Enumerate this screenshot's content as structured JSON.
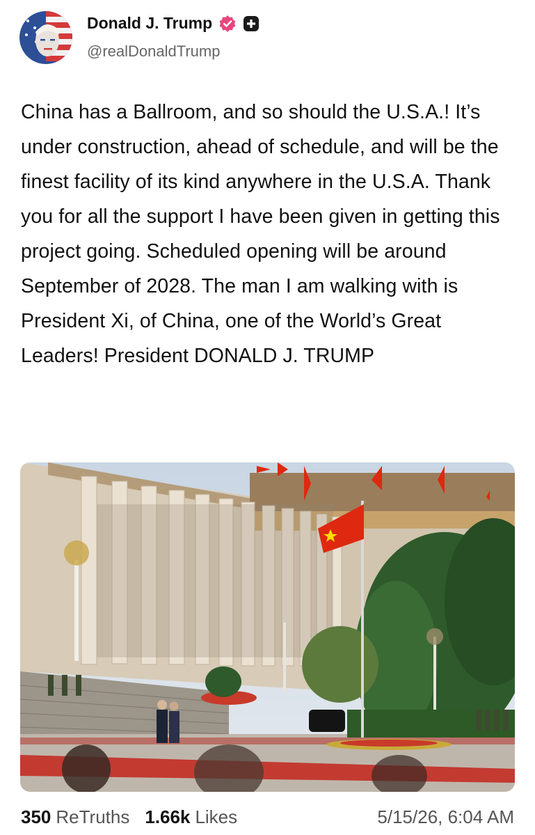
{
  "post": {
    "author_name": "Donald J. Trump",
    "author_handle": "@realDonaldTrump",
    "text": "China has a Ballroom, and so should the U.S.A.! It’s under construction, ahead of schedule, and will be the finest facility of its kind anywhere in the U.S.A. Thank you for all the support I have been given in getting this project going. Scheduled opening will be around September of 2028. The man I am walking with is President Xi, of China, one of the World’s Great Leaders! President DONALD J. TRUMP"
  },
  "icons": {
    "verified": "verified-badge-icon",
    "plus": "plus-square-icon",
    "avatar": "flag-portrait-avatar",
    "photo": "ceremony-photo"
  },
  "stats": {
    "retruths_count": "350",
    "retruths_label": "ReTruths",
    "likes_count": "1.66k",
    "likes_label": "Likes",
    "timestamp": "5/15/26, 6:04 AM"
  },
  "colors": {
    "verified_badge": "#e8467c",
    "text_primary": "#111111",
    "text_secondary": "#666666"
  }
}
